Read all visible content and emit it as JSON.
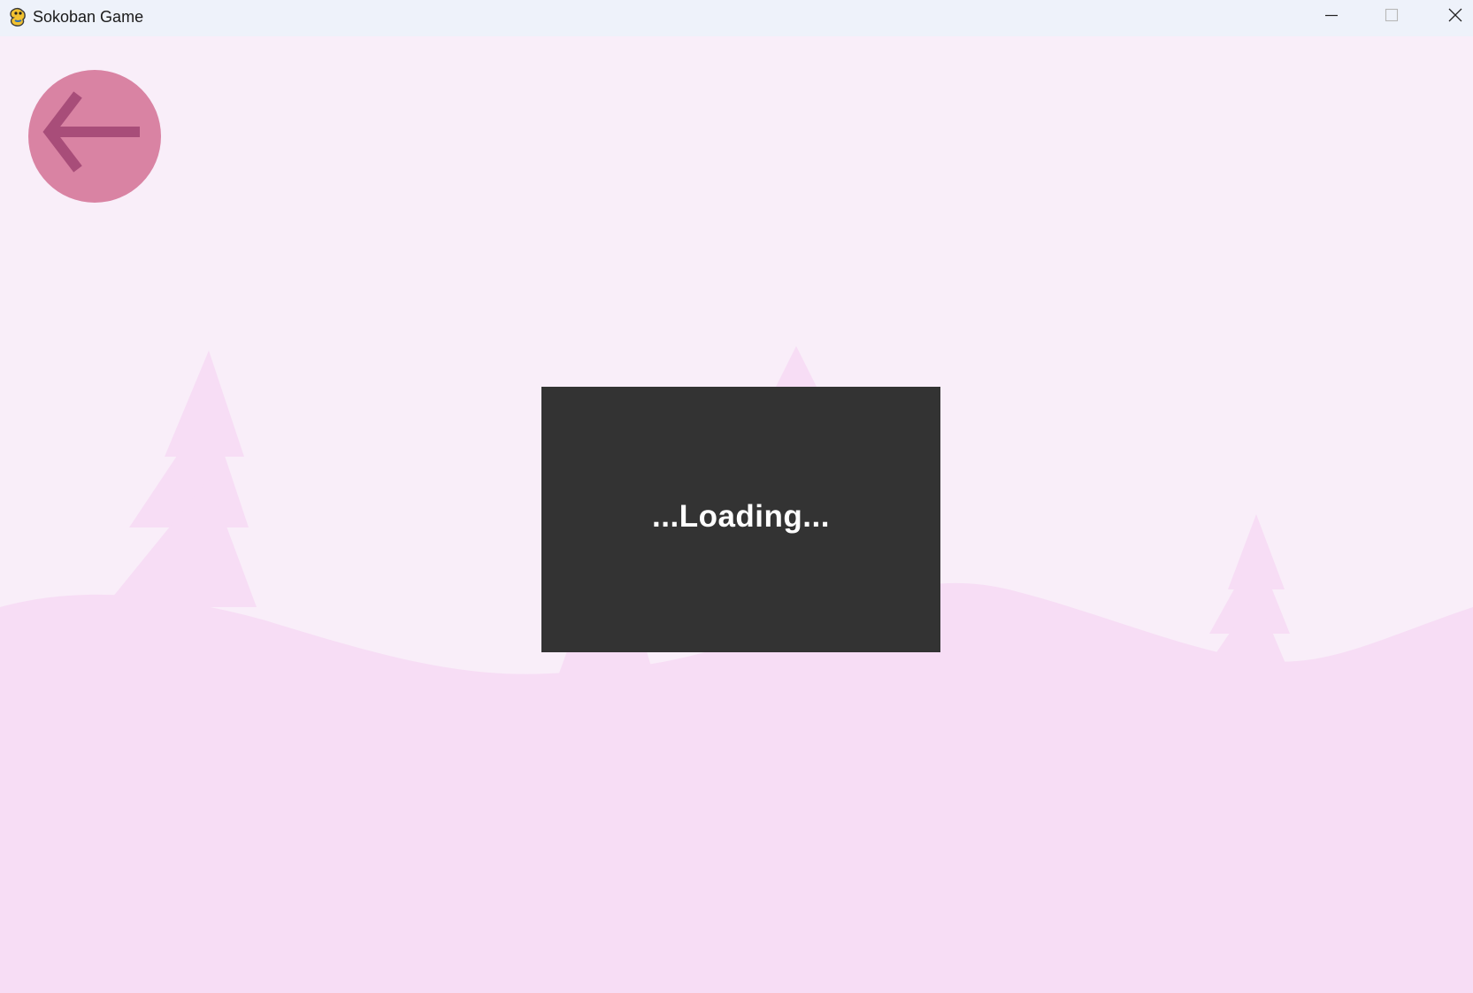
{
  "window": {
    "title": "Sokoban Game",
    "icon": "pygame-snake-icon",
    "controls": {
      "minimize_icon": "minimize-icon",
      "maximize_icon": "maximize-icon",
      "close_icon": "close-icon"
    }
  },
  "game": {
    "back_button_icon": "arrow-left-icon",
    "loading_text": "...Loading...",
    "colors": {
      "background": "#f9eef9",
      "hills": "#f7ddf5",
      "trees": "#f7ddf5",
      "back_button": "#d983a3",
      "back_arrow": "#a84d79",
      "loading_box": "#333333",
      "loading_text": "#ffffff"
    }
  }
}
